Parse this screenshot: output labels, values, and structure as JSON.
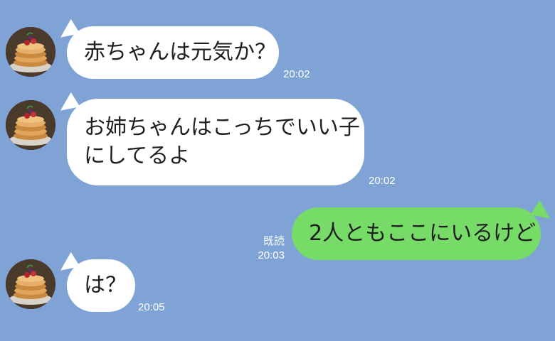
{
  "messages": [
    {
      "side": "incoming",
      "lines": [
        "赤ちゃんは元気か？"
      ],
      "time": "20:02"
    },
    {
      "side": "incoming",
      "lines": [
        "お姉ちゃんはこっちでいい子",
        "にしてるよ"
      ],
      "time": "20:02"
    },
    {
      "side": "outgoing",
      "lines": [
        "2人ともここにいるけど"
      ],
      "read": "既読",
      "time": "20:03"
    },
    {
      "side": "incoming",
      "lines": [
        "は？"
      ],
      "time": "20:05"
    }
  ],
  "avatar_icon": "pancake-stack-avatar",
  "colors": {
    "background": "#7fa3d5",
    "incoming_bubble": "#ffffff",
    "outgoing_bubble": "#77dc67",
    "meta_text": "#ffffff"
  }
}
